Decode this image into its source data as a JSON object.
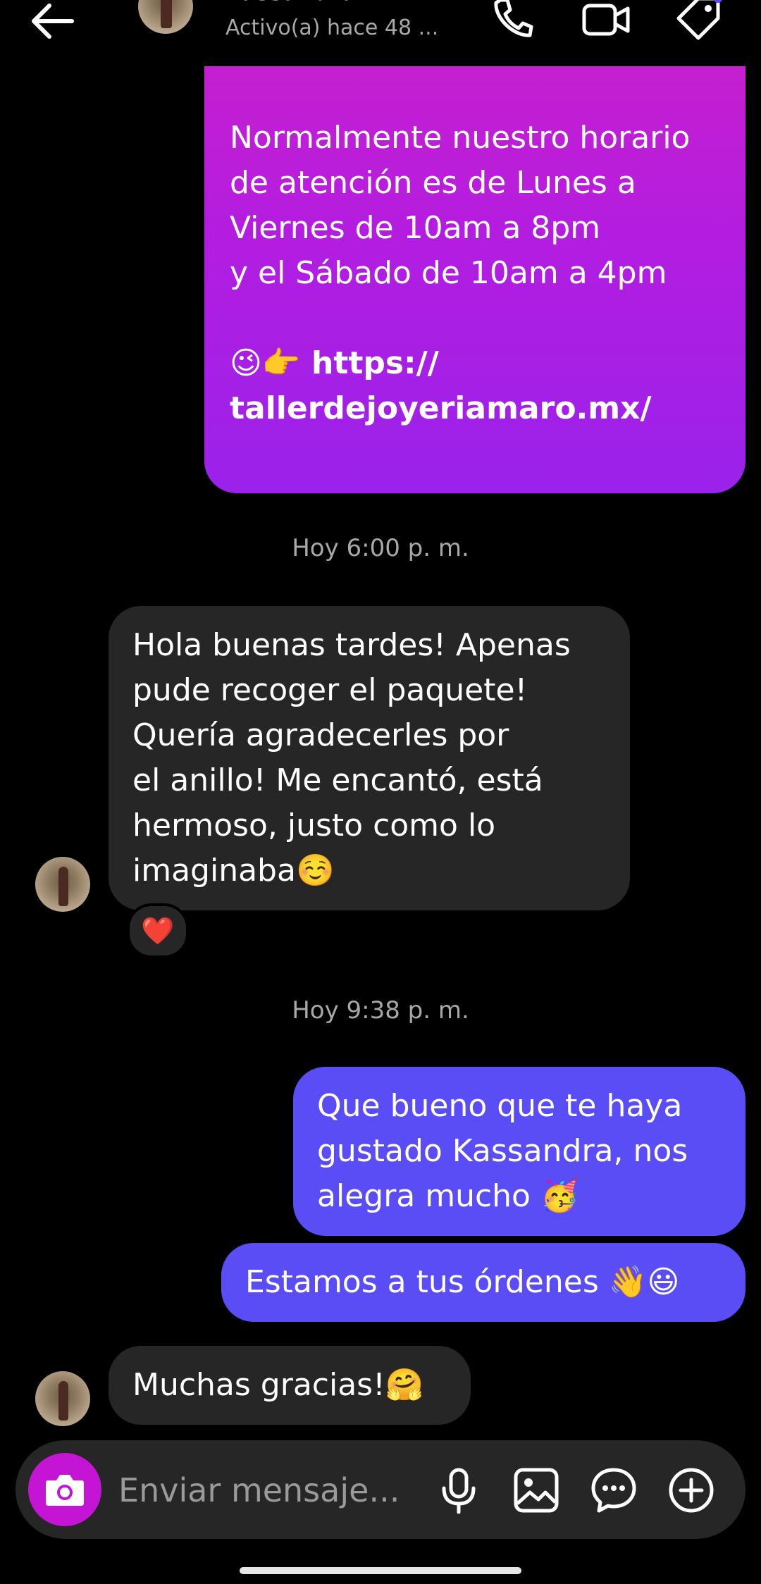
{
  "header": {
    "contact_name": "kassandra",
    "status": "Activo(a) hace 48 ...",
    "icons": [
      "back-arrow-icon",
      "phone-icon",
      "video-camera-icon",
      "tag-icon"
    ]
  },
  "messages": {
    "business_info": {
      "lines": [
        "Normalmente nuestro horario",
        "de atención es de Lunes a",
        "Viernes de 10am a 8pm",
        "y el Sábado de 10am a 4pm"
      ],
      "emoji": "😉👉",
      "link_line1": "https://",
      "link_line2": "tallerdejoyeriamaro.mx/"
    },
    "timestamp_1": "Hoy 6:00 p. m.",
    "incoming_1": {
      "lines": [
        "Hola buenas tardes! Apenas",
        "pude recoger el paquete!",
        "Quería agradecerles por",
        "el anillo! Me encantó, está",
        "hermoso, justo como lo",
        "imaginaba☺️"
      ],
      "reaction": "❤️"
    },
    "timestamp_2": "Hoy 9:38 p. m.",
    "outgoing_1": {
      "lines": [
        "Que bueno que te haya",
        "gustado Kassandra, nos",
        "alegra mucho 🥳"
      ]
    },
    "outgoing_2": "Estamos a tus órdenes 👋😃",
    "incoming_2": "Muchas gracias!🤗"
  },
  "composer": {
    "placeholder": "Enviar mensaje...",
    "icons": [
      "camera-icon",
      "microphone-icon",
      "gallery-icon",
      "chat-bubble-icon",
      "plus-circle-icon"
    ]
  },
  "colors": {
    "background": "#000000",
    "incoming_bubble": "#262626",
    "outgoing_bubble": "#5b4df5",
    "gradient_top": "#c51fd0",
    "gradient_bottom": "#9a22ea",
    "camera_button": "#c415d4"
  }
}
